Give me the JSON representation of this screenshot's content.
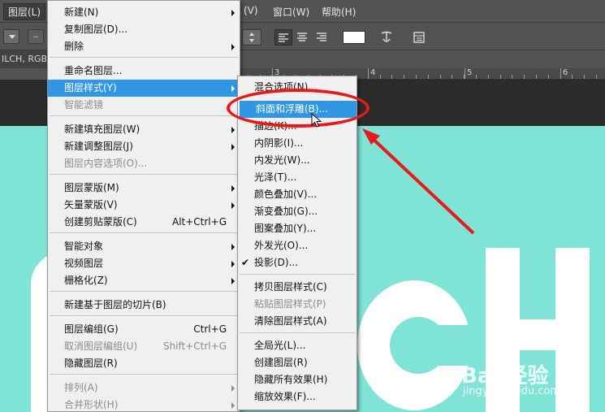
{
  "menubar": {
    "items": [
      "图层(L)",
      "图层(V)",
      "窗口(W)",
      "帮助(H)"
    ],
    "visible_right_labels": [
      "(V)",
      "窗口(W)",
      "帮助(H)"
    ]
  },
  "document": {
    "tab_label": "ILCH, RGB/"
  },
  "ruler": {
    "labels": [
      "3",
      "4",
      "5",
      "6"
    ]
  },
  "canvas_text": {
    "letters": "CH"
  },
  "watermark": {
    "brand": "Bai 经验",
    "url": "jingyan.baidu.com"
  },
  "layer_menu": {
    "items": [
      {
        "label": "新建(N)",
        "shortcut": "",
        "submenu": true,
        "disabled": false
      },
      {
        "label": "复制图层(D)...",
        "shortcut": "",
        "submenu": false,
        "disabled": false
      },
      {
        "label": "删除",
        "shortcut": "",
        "submenu": true,
        "disabled": false
      },
      {
        "label": "重命名图层...",
        "shortcut": "",
        "submenu": false,
        "disabled": false
      },
      {
        "label": "图层样式(Y)",
        "shortcut": "",
        "submenu": true,
        "disabled": false,
        "highlighted": true
      },
      {
        "label": "智能滤镜",
        "shortcut": "",
        "submenu": false,
        "disabled": true
      },
      {
        "label": "新建填充图层(W)",
        "shortcut": "",
        "submenu": true,
        "disabled": false
      },
      {
        "label": "新建调整图层(J)",
        "shortcut": "",
        "submenu": true,
        "disabled": false
      },
      {
        "label": "图层内容选项(O)...",
        "shortcut": "",
        "submenu": false,
        "disabled": true
      },
      {
        "label": "图层蒙版(M)",
        "shortcut": "",
        "submenu": true,
        "disabled": false
      },
      {
        "label": "矢量蒙版(V)",
        "shortcut": "",
        "submenu": true,
        "disabled": false
      },
      {
        "label": "创建剪贴蒙版(C)",
        "shortcut": "Alt+Ctrl+G",
        "submenu": false,
        "disabled": false
      },
      {
        "label": "智能对象",
        "shortcut": "",
        "submenu": true,
        "disabled": false
      },
      {
        "label": "视频图层",
        "shortcut": "",
        "submenu": true,
        "disabled": false
      },
      {
        "label": "栅格化(Z)",
        "shortcut": "",
        "submenu": true,
        "disabled": false
      },
      {
        "label": "新建基于图层的切片(B)",
        "shortcut": "",
        "submenu": false,
        "disabled": false
      },
      {
        "label": "图层编组(G)",
        "shortcut": "Ctrl+G",
        "submenu": false,
        "disabled": false
      },
      {
        "label": "取消图层编组(U)",
        "shortcut": "Shift+Ctrl+G",
        "submenu": false,
        "disabled": true
      },
      {
        "label": "隐藏图层(R)",
        "shortcut": "",
        "submenu": false,
        "disabled": false
      },
      {
        "label": "排列(A)",
        "shortcut": "",
        "submenu": true,
        "disabled": true
      },
      {
        "label": "合并形状(H)",
        "shortcut": "",
        "submenu": true,
        "disabled": true
      }
    ]
  },
  "style_submenu": {
    "items": [
      {
        "label": "混合选项(N)...",
        "disabled": false,
        "checked": false
      },
      {
        "label": "斜面和浮雕(B)...",
        "disabled": false,
        "checked": false,
        "highlighted": true
      },
      {
        "label": "描边(K)...",
        "disabled": false,
        "checked": false
      },
      {
        "label": "内阴影(I)...",
        "disabled": false,
        "checked": false
      },
      {
        "label": "内发光(W)...",
        "disabled": false,
        "checked": false
      },
      {
        "label": "光泽(T)...",
        "disabled": false,
        "checked": false
      },
      {
        "label": "颜色叠加(V)...",
        "disabled": false,
        "checked": false
      },
      {
        "label": "渐变叠加(G)...",
        "disabled": false,
        "checked": false
      },
      {
        "label": "图案叠加(Y)...",
        "disabled": false,
        "checked": false
      },
      {
        "label": "外发光(O)...",
        "disabled": false,
        "checked": false
      },
      {
        "label": "投影(D)...",
        "disabled": false,
        "checked": true
      },
      {
        "label": "拷贝图层样式(C)",
        "disabled": false,
        "checked": false
      },
      {
        "label": "粘贴图层样式(P)",
        "disabled": true,
        "checked": false
      },
      {
        "label": "清除图层样式(A)",
        "disabled": false,
        "checked": false
      },
      {
        "label": "全局光(L)...",
        "disabled": false,
        "checked": false
      },
      {
        "label": "创建图层(R)",
        "disabled": false,
        "checked": false
      },
      {
        "label": "隐藏所有效果(H)",
        "disabled": false,
        "checked": false
      },
      {
        "label": "缩放效果(F)...",
        "disabled": false,
        "checked": false
      }
    ]
  },
  "colors": {
    "highlight": "#3196e4",
    "canvas": "#7fe3d6",
    "annotation": "#e81919"
  }
}
